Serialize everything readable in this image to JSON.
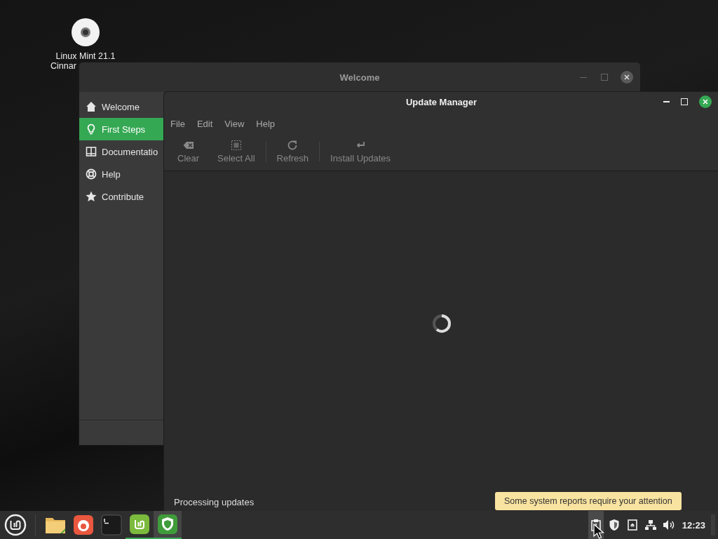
{
  "desktop_icon": {
    "label_lines": [
      "Linux Mint 21.1",
      "Cinnar"
    ]
  },
  "welcome_window": {
    "title": "Welcome",
    "sidebar": {
      "items": [
        {
          "label": "Welcome",
          "selected": false
        },
        {
          "label": "First Steps",
          "selected": true
        },
        {
          "label": "Documentatio",
          "selected": false
        },
        {
          "label": "Help",
          "selected": false
        },
        {
          "label": "Contribute",
          "selected": false
        }
      ]
    }
  },
  "update_manager": {
    "title": "Update Manager",
    "menu": [
      "File",
      "Edit",
      "View",
      "Help"
    ],
    "toolbar": [
      {
        "label": "Clear",
        "disabled": true
      },
      {
        "label": "Select All",
        "disabled": true
      },
      {
        "label": "Refresh",
        "disabled": true
      },
      {
        "label": "Install Updates",
        "disabled": true
      }
    ],
    "status": "Processing updates"
  },
  "tooltip": "Some system reports require your attention",
  "taskbar": {
    "launchers": [
      {
        "running": false,
        "selected": false
      },
      {
        "running": false,
        "selected": false
      },
      {
        "running": false,
        "selected": false
      },
      {
        "running": true,
        "selected": false
      },
      {
        "running": true,
        "selected": true
      }
    ],
    "clock": "12:23"
  }
}
